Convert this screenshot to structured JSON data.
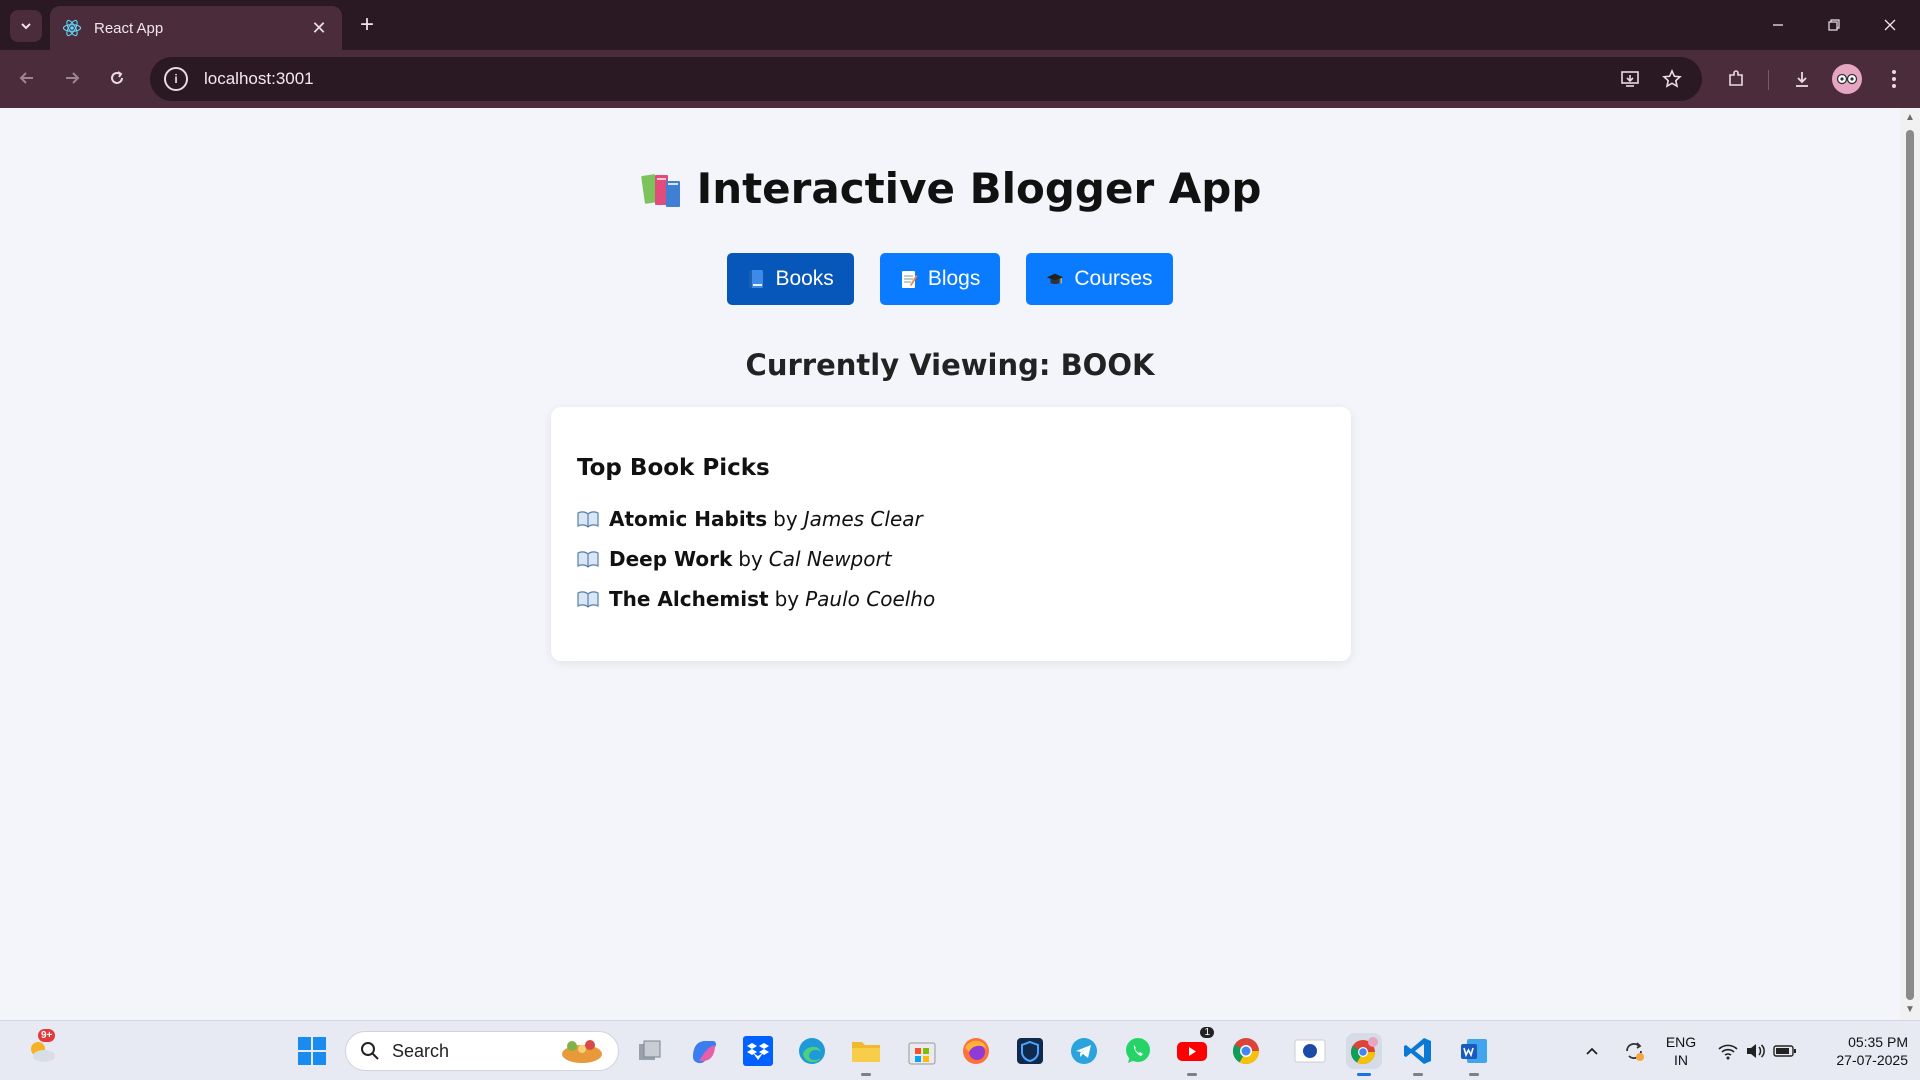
{
  "browser": {
    "tab_title": "React App",
    "tab_close": "✕",
    "new_tab": "+",
    "url": "localhost:3001"
  },
  "page": {
    "title": "Interactive Blogger App",
    "nav_buttons": [
      {
        "label": "Books",
        "active": true
      },
      {
        "label": "Blogs",
        "active": false
      },
      {
        "label": "Courses",
        "active": false
      }
    ],
    "currently_viewing": "Currently Viewing: BOOK",
    "card": {
      "heading": "Top Book Picks",
      "books": [
        {
          "title": "Atomic Habits",
          "by": "by",
          "author": "James Clear"
        },
        {
          "title": "Deep Work",
          "by": "by",
          "author": "Cal Newport"
        },
        {
          "title": "The Alchemist",
          "by": "by",
          "author": "Paulo Coelho"
        }
      ]
    }
  },
  "taskbar": {
    "weather_badge": "9+",
    "search_placeholder": "Search",
    "language_top": "ENG",
    "language_bottom": "IN",
    "time": "05:35 PM",
    "date": "27-07-2025",
    "youtube_badge": "1"
  },
  "colors": {
    "button_primary": "#0a7bff",
    "button_active": "#0756b9",
    "page_background": "#f3f5fb",
    "chrome_dark": "#2a1823",
    "chrome_toolbar": "#4a2c3b"
  }
}
